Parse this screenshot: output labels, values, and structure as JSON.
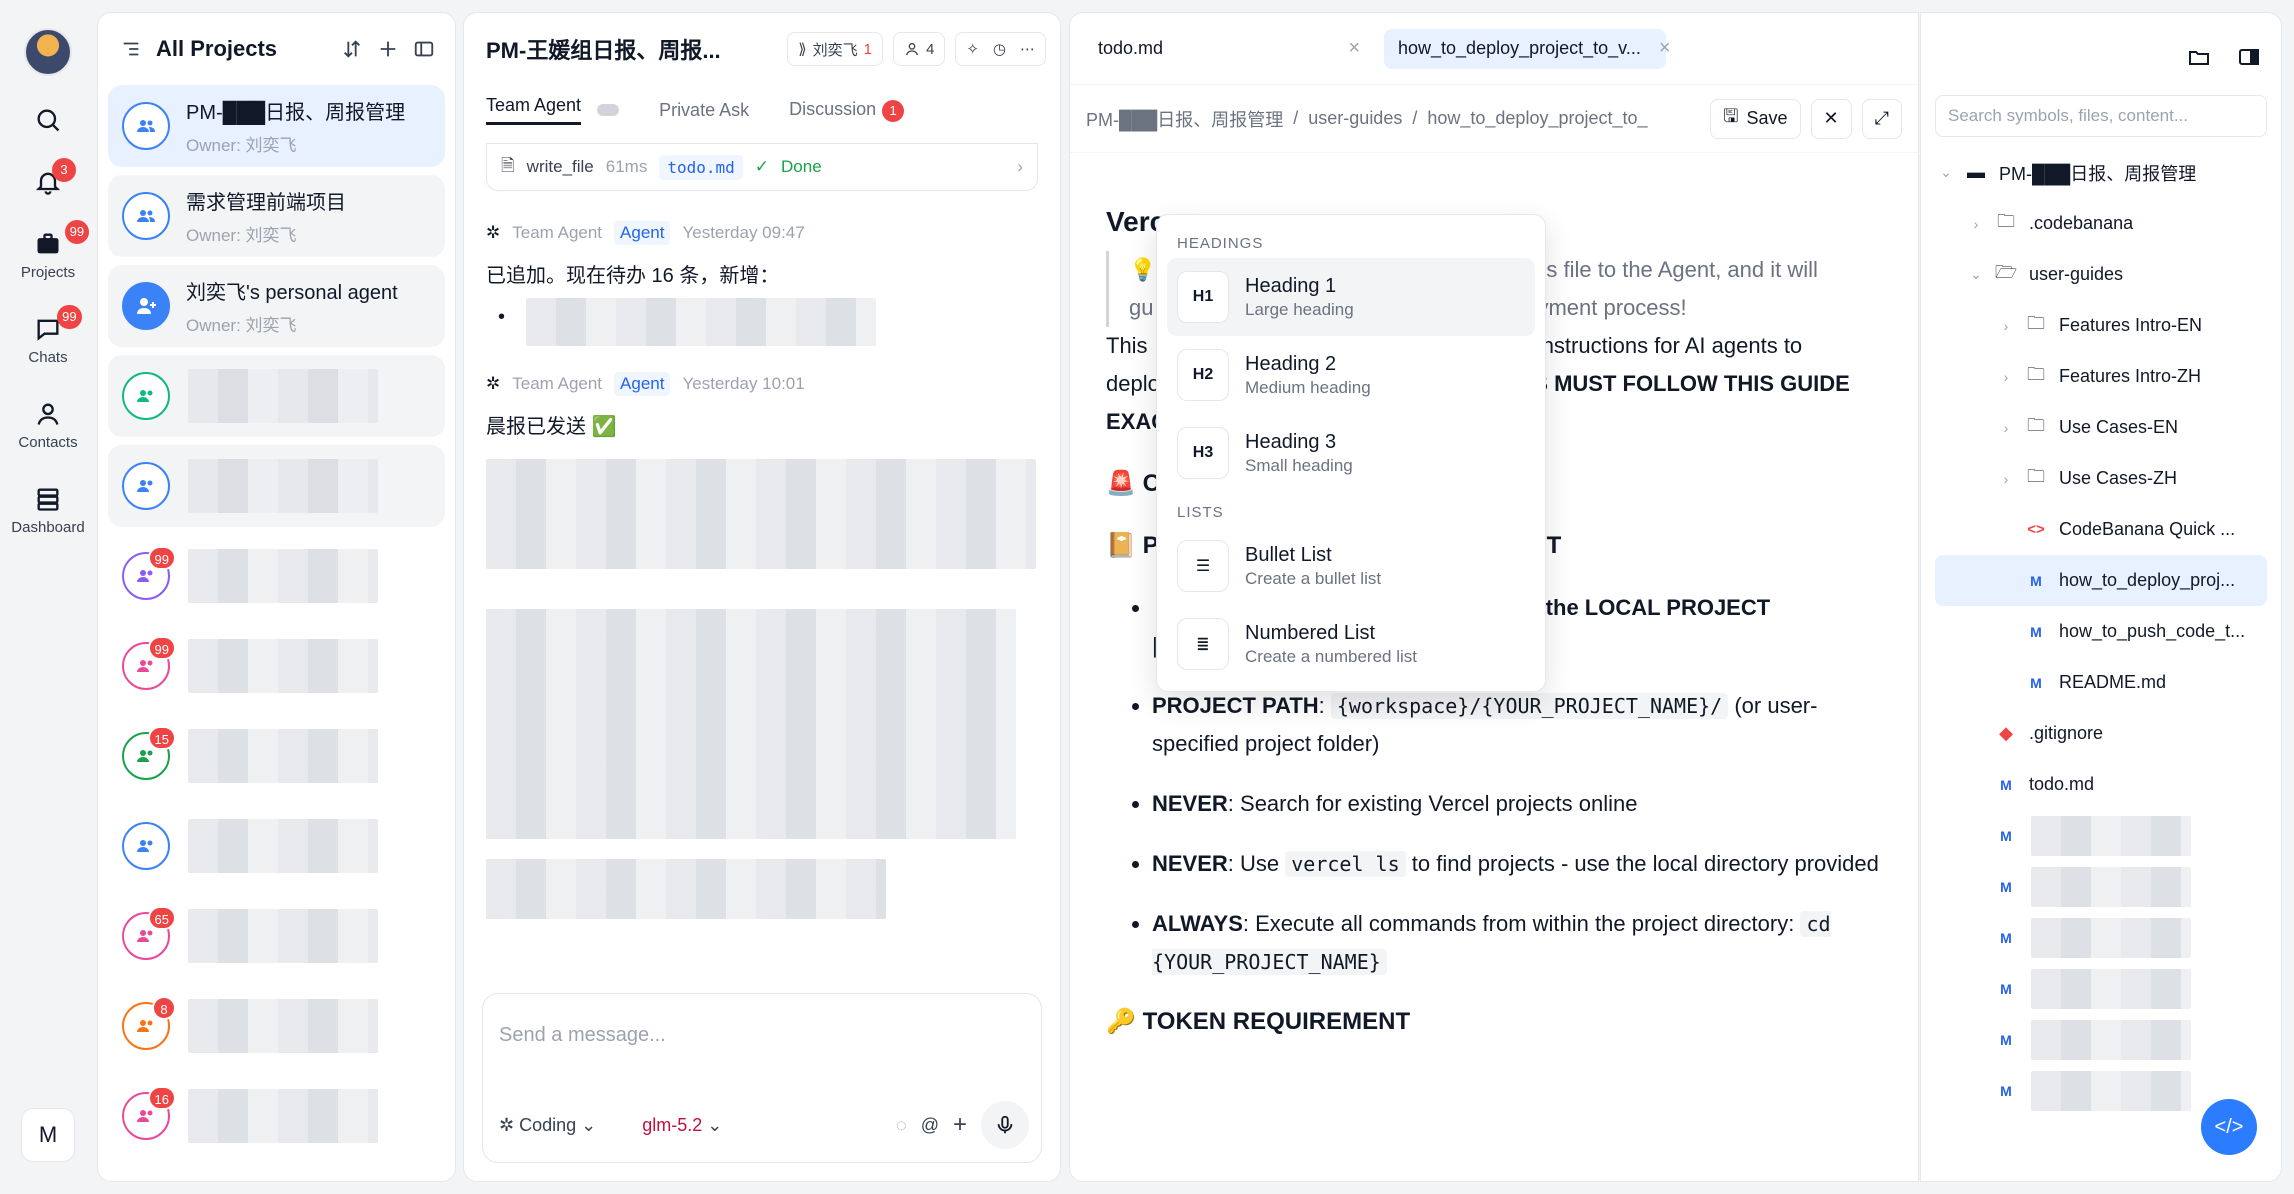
{
  "rail": {
    "bell_badge": "3",
    "projects_badge": "99",
    "projects_label": "Projects",
    "chats_badge": "99",
    "chats_label": "Chats",
    "contacts_label": "Contacts",
    "dashboard_label": "Dashboard",
    "bottom_avatar": "M"
  },
  "projects": {
    "title": "All Projects",
    "items": [
      {
        "name": "PM-███日报、周报管理",
        "owner": "Owner: 刘奕飞"
      },
      {
        "name": "需求管理前端项目",
        "owner": "Owner: 刘奕飞"
      },
      {
        "name": "刘奕飞's personal agent",
        "owner": "Owner: 刘奕飞"
      }
    ],
    "badges": [
      "99",
      "99",
      "15",
      "65",
      "8",
      "16"
    ]
  },
  "chat": {
    "title": "PM-王媛组日报、周报...",
    "user_chip": "刘奕飞",
    "user_chip_count": "1",
    "member_count": "4",
    "tabs": {
      "team": "Team Agent",
      "private": "Private Ask",
      "discussion": "Discussion",
      "discussion_badge": "1"
    },
    "tool": {
      "name": "write_file",
      "time": "61ms",
      "file": "todo.md",
      "status": "Done"
    },
    "messages": [
      {
        "sender": "Team Agent",
        "tag": "Agent",
        "time": "Yesterday 09:47",
        "text": "已追加。现在待办 16 条，新增："
      },
      {
        "sender": "Team Agent",
        "tag": "Agent",
        "time": "Yesterday 10:01",
        "text": "晨报已发送 ✅"
      }
    ],
    "composer": {
      "placeholder": "Send a message...",
      "mode": "Coding",
      "model": "glm-5.2"
    }
  },
  "editor": {
    "tabs": [
      {
        "label": "todo.md"
      },
      {
        "label": "how_to_deploy_project_to_v..."
      }
    ],
    "crumbs": [
      "PM-███日报、周报管理",
      "user-guides",
      "how_to_deploy_project_to_"
    ],
    "save_label": "Save",
    "doc": {
      "h_start": "Verc",
      "quote_a": "s file to the Agent, and it will",
      "quote_b": "gu",
      "quote_c": "yment process!",
      "p1a": "This ",
      "p1b": "nstructions for AI agents to",
      "p2a": "deplo",
      "p2b": "TS MUST FOLLOW THIS GUIDE",
      "p3": "EXAC",
      "sec1": "C",
      "sec2": "P",
      "sec2b": "T",
      "li1_tail": "m the LOCAL PROJECT",
      "li2_label": "PROJECT PATH",
      "li2_code": "{workspace}/{YOUR_PROJECT_NAME}/",
      "li2_rest": "(or user-specified project folder)",
      "li3_label": "NEVER",
      "li3_text": ": Search for existing Vercel projects online",
      "li4_label": "NEVER",
      "li4_pre": ": Use ",
      "li4_code": "vercel ls",
      "li4_post": " to find projects - use the local directory provided",
      "li5_label": "ALWAYS",
      "li5_pre": ": Execute all commands from within the project directory: ",
      "li5_code": "cd {YOUR_PROJECT_NAME}",
      "token_title": "TOKEN REQUIREMENT"
    }
  },
  "menu": {
    "sections": {
      "headings": "HEADINGS",
      "lists": "LISTS"
    },
    "items": [
      {
        "icon": "H1",
        "title": "Heading 1",
        "desc": "Large heading"
      },
      {
        "icon": "H2",
        "title": "Heading 2",
        "desc": "Medium heading"
      },
      {
        "icon": "H3",
        "title": "Heading 3",
        "desc": "Small heading"
      },
      {
        "title": "Bullet List",
        "desc": "Create a bullet list"
      },
      {
        "title": "Numbered List",
        "desc": "Create a numbered list"
      }
    ]
  },
  "tree": {
    "search_placeholder": "Search symbols, files, content...",
    "root": "PM-███日报、周报管理",
    "items": [
      ".codebanana",
      "user-guides",
      "Features Intro-EN",
      "Features Intro-ZH",
      "Use Cases-EN",
      "Use Cases-ZH",
      "CodeBanana Quick ...",
      "how_to_deploy_proj...",
      "how_to_push_code_t...",
      "README.md",
      ".gitignore",
      "todo.md"
    ]
  },
  "icons": [
    "search-icon",
    "bell-icon",
    "briefcase-icon",
    "chat-icon",
    "user-icon",
    "stack-icon",
    "users-icon",
    "folder-icon",
    "chevron-right-icon",
    "chevron-down-icon",
    "close-icon",
    "save-icon",
    "expand-icon",
    "mic-icon",
    "plus-icon",
    "at-icon",
    "code-icon"
  ],
  "colors": {
    "accent": "#2b7cff",
    "badge": "#ef4444",
    "selected": "#e8f1ff",
    "model": "#be123c"
  }
}
